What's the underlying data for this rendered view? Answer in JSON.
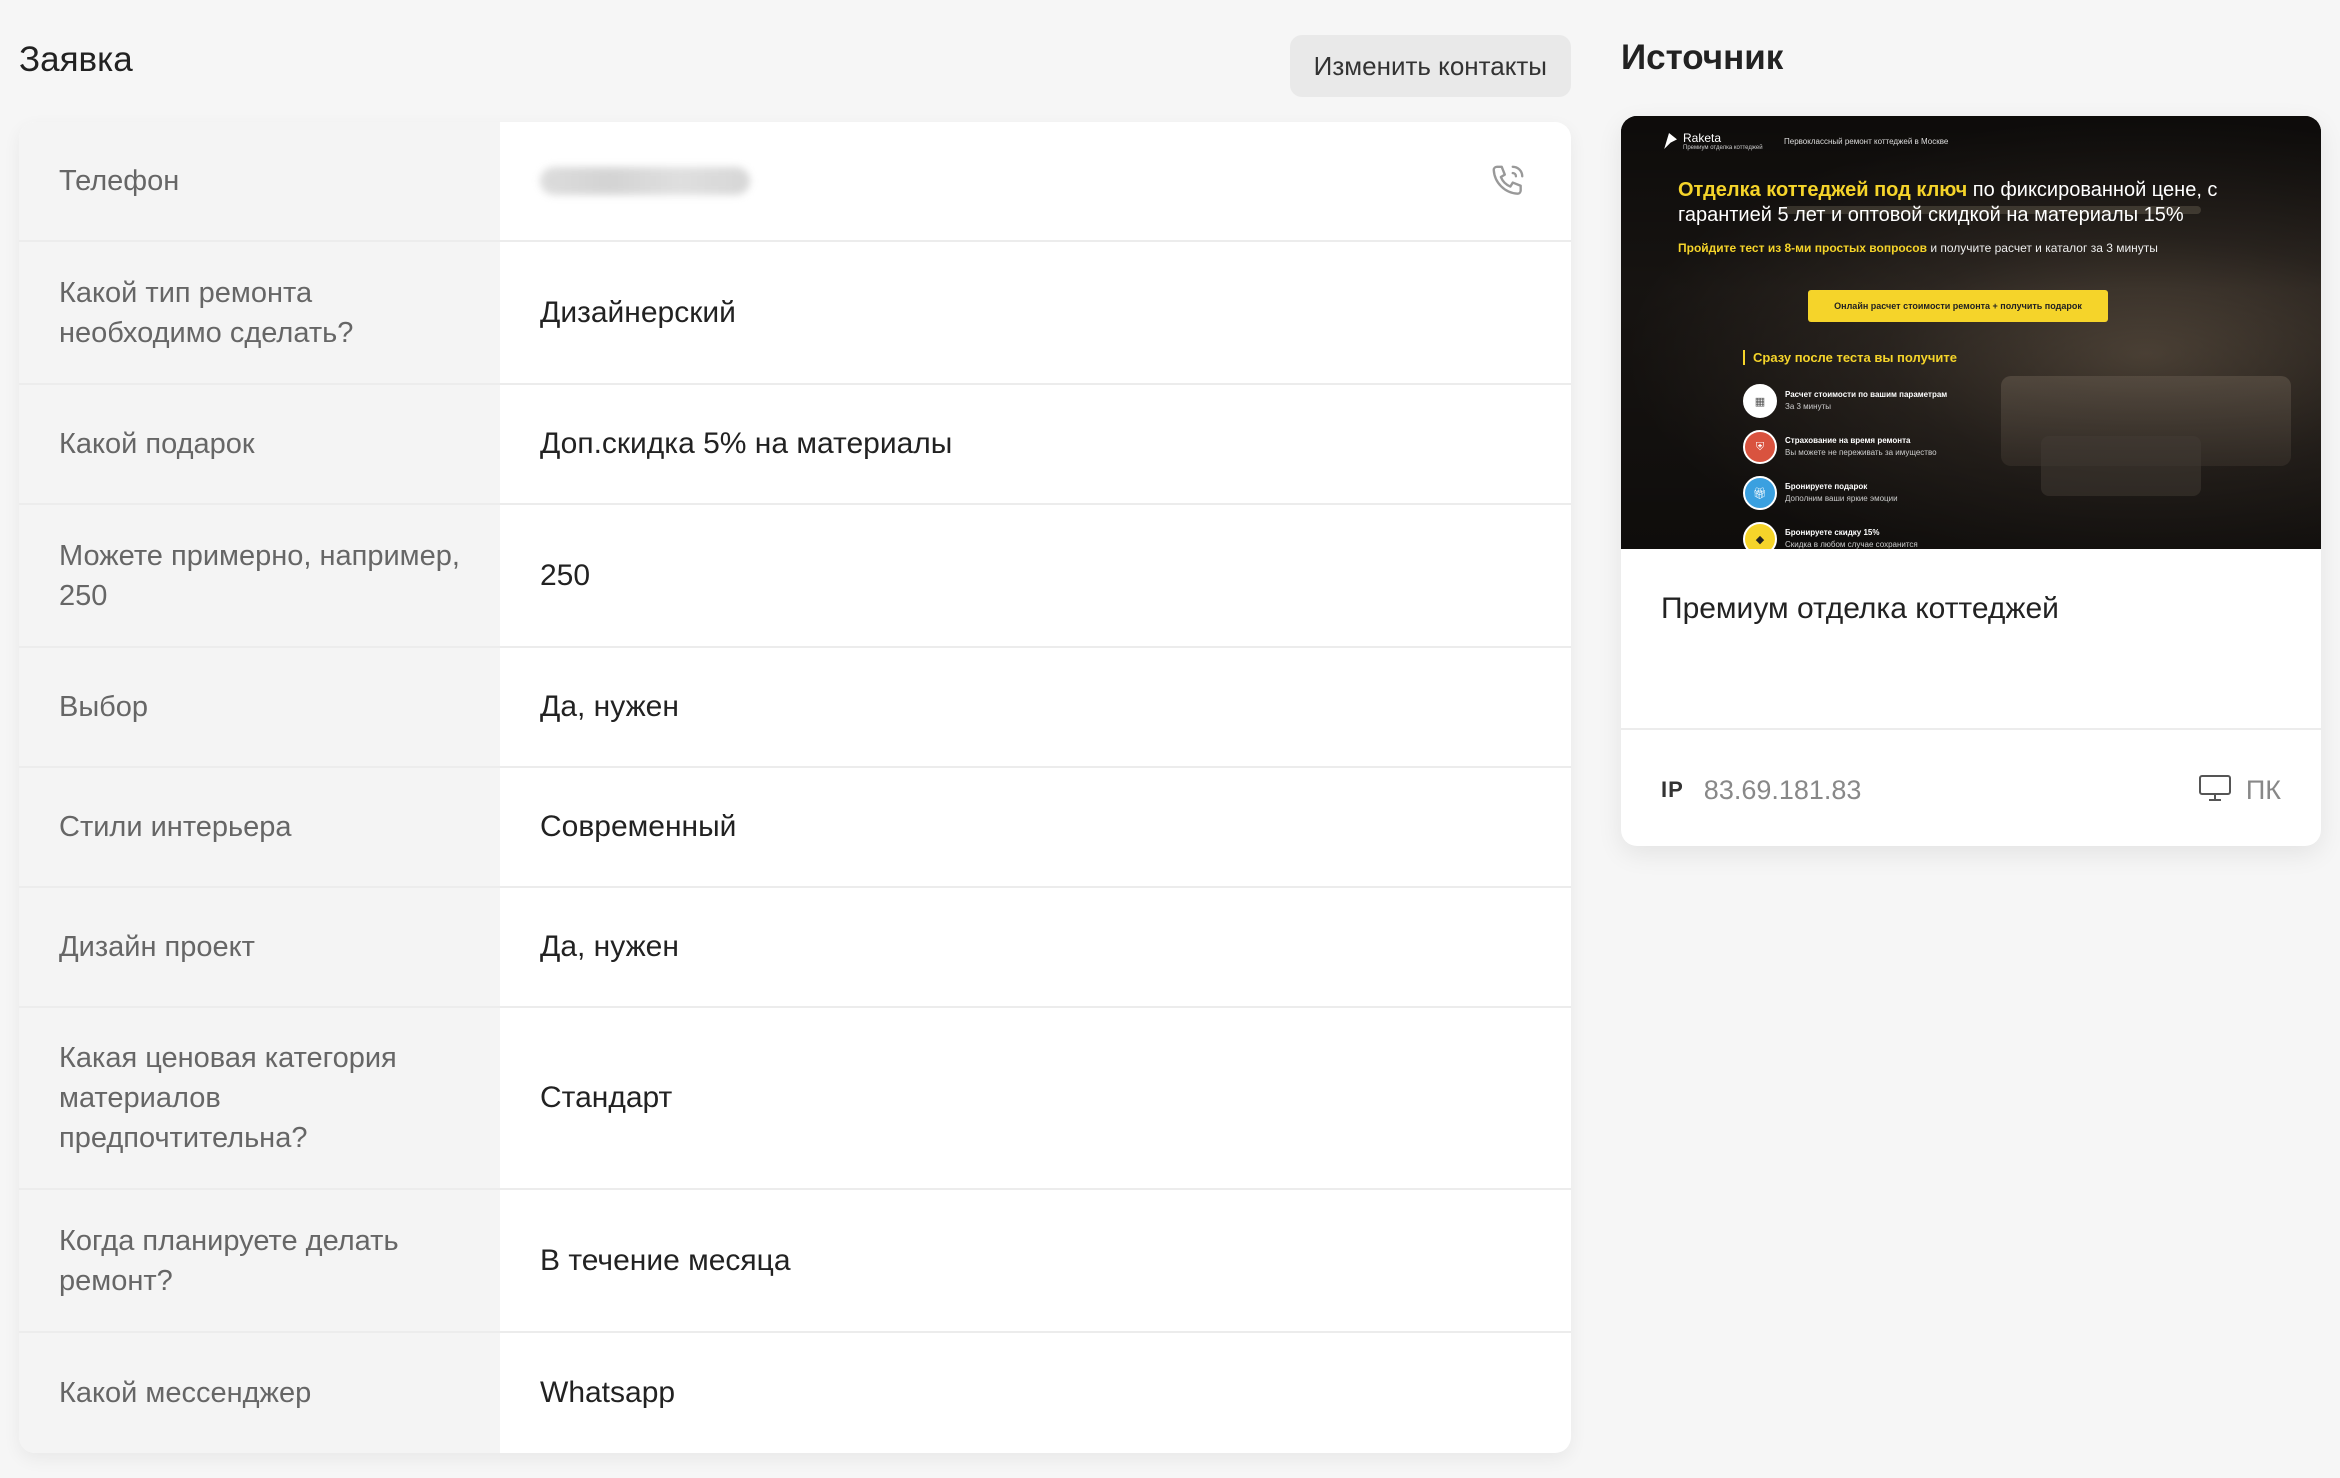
{
  "request": {
    "title": "Заявка",
    "edit_button": "Изменить контакты",
    "rows": [
      {
        "label": "Телефон",
        "value": ""
      },
      {
        "label": "Какой тип ремонта необходимо сделать?",
        "value": "Дизайнерский"
      },
      {
        "label": "Какой подарок",
        "value": "Доп.скидка 5% на материалы"
      },
      {
        "label": "Можете примерно, например, 250",
        "value": "250"
      },
      {
        "label": "Выбор",
        "value": "Да, нужен"
      },
      {
        "label": "Стили интерьера",
        "value": "Современный"
      },
      {
        "label": "Дизайн проект",
        "value": "Да, нужен"
      },
      {
        "label": "Какая ценовая категория материалов предпочтительна?",
        "value": "Стандарт"
      },
      {
        "label": "Когда планируете делать ремонт?",
        "value": "В течение месяца"
      },
      {
        "label": "Какой мессенджер",
        "value": "Whatsapp"
      }
    ],
    "phone_icon": "phone-call-icon"
  },
  "source": {
    "title": "Источник",
    "preview": {
      "logo": "Raketa",
      "logo_sub": "Премиум отделка коттеджей",
      "top_text": "Первоклассный ремонт коттеджей в Москве",
      "headline_highlight": "Отделка коттеджей под ключ",
      "headline_rest": " по фиксированной цене, с гарантией 5 лет и оптовой скидкой на материалы 15%",
      "sub_highlight": "Пройдите тест из 8-ми простых вопросов",
      "sub_rest": " и получите расчет и каталог за 3 минуты",
      "cta": "Онлайн расчет стоимости ремонта + получить подарок",
      "after_test": "Сразу после теста вы получите",
      "items": [
        {
          "title": "Расчет стоимости по вашим параметрам",
          "text": "За 3 минуты",
          "color": "#ffffff"
        },
        {
          "title": "Страхование на время ремонта",
          "text": "Вы можете не переживать за имущество",
          "color": "#d9533f"
        },
        {
          "title": "Бронируете подарок",
          "text": "Дополним ваши яркие эмоции",
          "color": "#3aa0e0"
        },
        {
          "title": "Бронируете скидку 15%",
          "text": "Скидка в любом случае сохранится",
          "color": "#f5d42a"
        }
      ]
    },
    "card_title": "Премиум отделка коттеджей",
    "ip_label": "IP",
    "ip_value": "83.69.181.83",
    "device_icon": "desktop-icon",
    "device_label": "ПК"
  }
}
